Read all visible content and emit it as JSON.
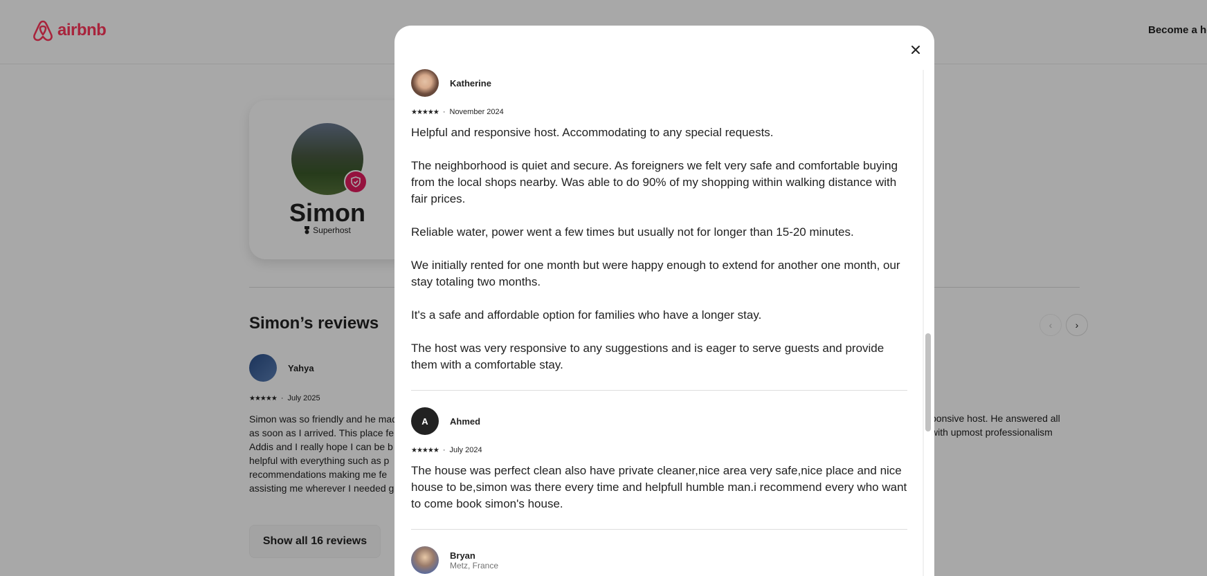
{
  "header": {
    "logo_text": "airbnb",
    "become_host": "Become a ho",
    "brand_color": "#ff385c"
  },
  "profile": {
    "name": "Simon",
    "badge": "Superhost"
  },
  "reviews_section": {
    "title": "Simon’s reviews",
    "prev_icon": "chevron-left-icon",
    "next_icon": "chevron-right-icon",
    "show_all_label": "Show all 16 reviews",
    "preview": {
      "name": "Yahya",
      "stars": "★★★★★",
      "dot": "·",
      "date": "July 2025",
      "text": "Simon was so friendly and he mad\nas soon as I arrived. This place fel\nAddis and I really hope I can be b\nhelpful with everything such as p\nrecommendations making me fe\nassisting me wherever I needed g"
    },
    "preview_right_text": "ponsive host. He answered all\nwith upmost professionalism"
  },
  "modal": {
    "close_icon": "close-icon",
    "reviews": [
      {
        "name": "Katherine",
        "stars": "★★★★★",
        "dot": "·",
        "date": "November 2024",
        "text": "Helpful and responsive host. Accommodating to any special requests.\n\nThe neighborhood is quiet and secure. As foreigners we felt very safe and comfortable buying from the local shops nearby. Was able to do 90% of my shopping within walking distance with fair prices.\n\nReliable water, power went a few times but usually not for longer than 15-20 minutes.\n\nWe initially rented for one month but were happy enough to extend for another one month, our stay totaling two months.\n\nIt's a safe and affordable option for families who have a longer stay.\n\nThe host was very responsive to any suggestions and is eager to serve guests and provide them with a comfortable stay."
      },
      {
        "name": "Ahmed",
        "initial": "A",
        "stars": "★★★★★",
        "dot": "·",
        "date": "July 2024",
        "text": "The house was perfect clean also have private cleaner,nice area very safe,nice place and nice house to be,simon was there every time and helpfull humble man.i recommend every who want to come book simon's house."
      },
      {
        "name": "Bryan",
        "location": "Metz, France"
      }
    ]
  }
}
